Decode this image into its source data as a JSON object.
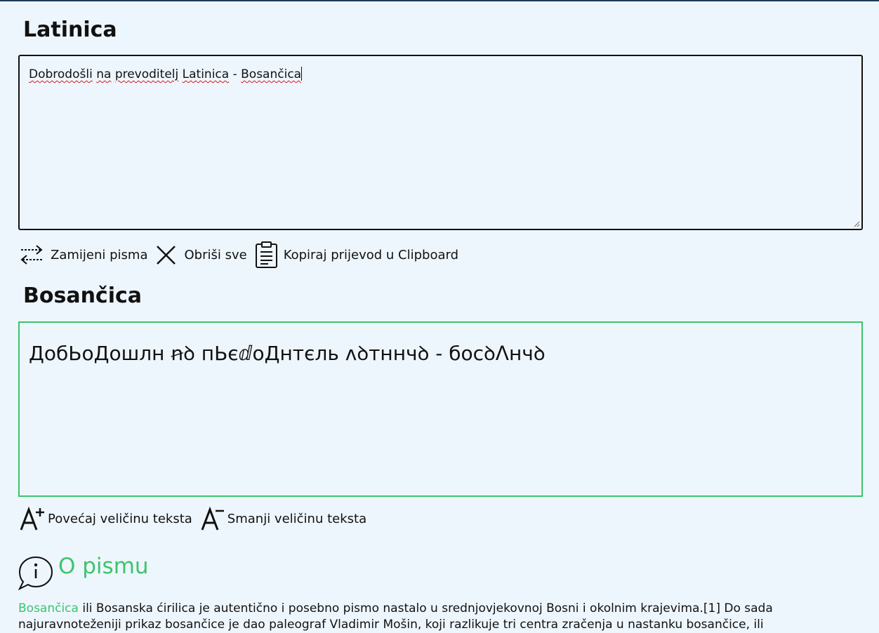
{
  "latin_section": {
    "title": "Latinica",
    "input": {
      "words": [
        "Dobrodošli",
        "na",
        "prevoditelj",
        "Latinica",
        "-",
        "Bosančica"
      ]
    }
  },
  "toolbar": {
    "swap_label": "Zamijeni pisma",
    "clear_label": "Obriši sve",
    "copy_label": "Kopiraj prijevod u Clipboard"
  },
  "bosancica_section": {
    "title": "Bosančica",
    "output_text": "ДобЬоДошлн ꞥꝺ пЬєⅆоДнтєль ʌꝺтннчꝺ - босꝺⴷнчꝺ"
  },
  "font_controls": {
    "increase_label": "Povećaj veličinu teksta",
    "decrease_label": "Smanji veličinu teksta"
  },
  "about": {
    "title": "O pismu",
    "link_text": "Bosančica",
    "paragraph_line1_rest": " ili Bosanska ćirilica je autentično i posebno pismo nastalo u srednjovjekovnoj Bosni i okolnim krajevima.[1] Do sada",
    "paragraph_line2": "najuravnoteženiji prikaz bosančice je dao paleograf Vladimir Mošin, koji razlikuje tri centra zračenja u nastanku bosančice, ili"
  },
  "colors": {
    "accent": "#3cc46d",
    "background": "#eef6fd",
    "spellcheck": "#d21919"
  }
}
